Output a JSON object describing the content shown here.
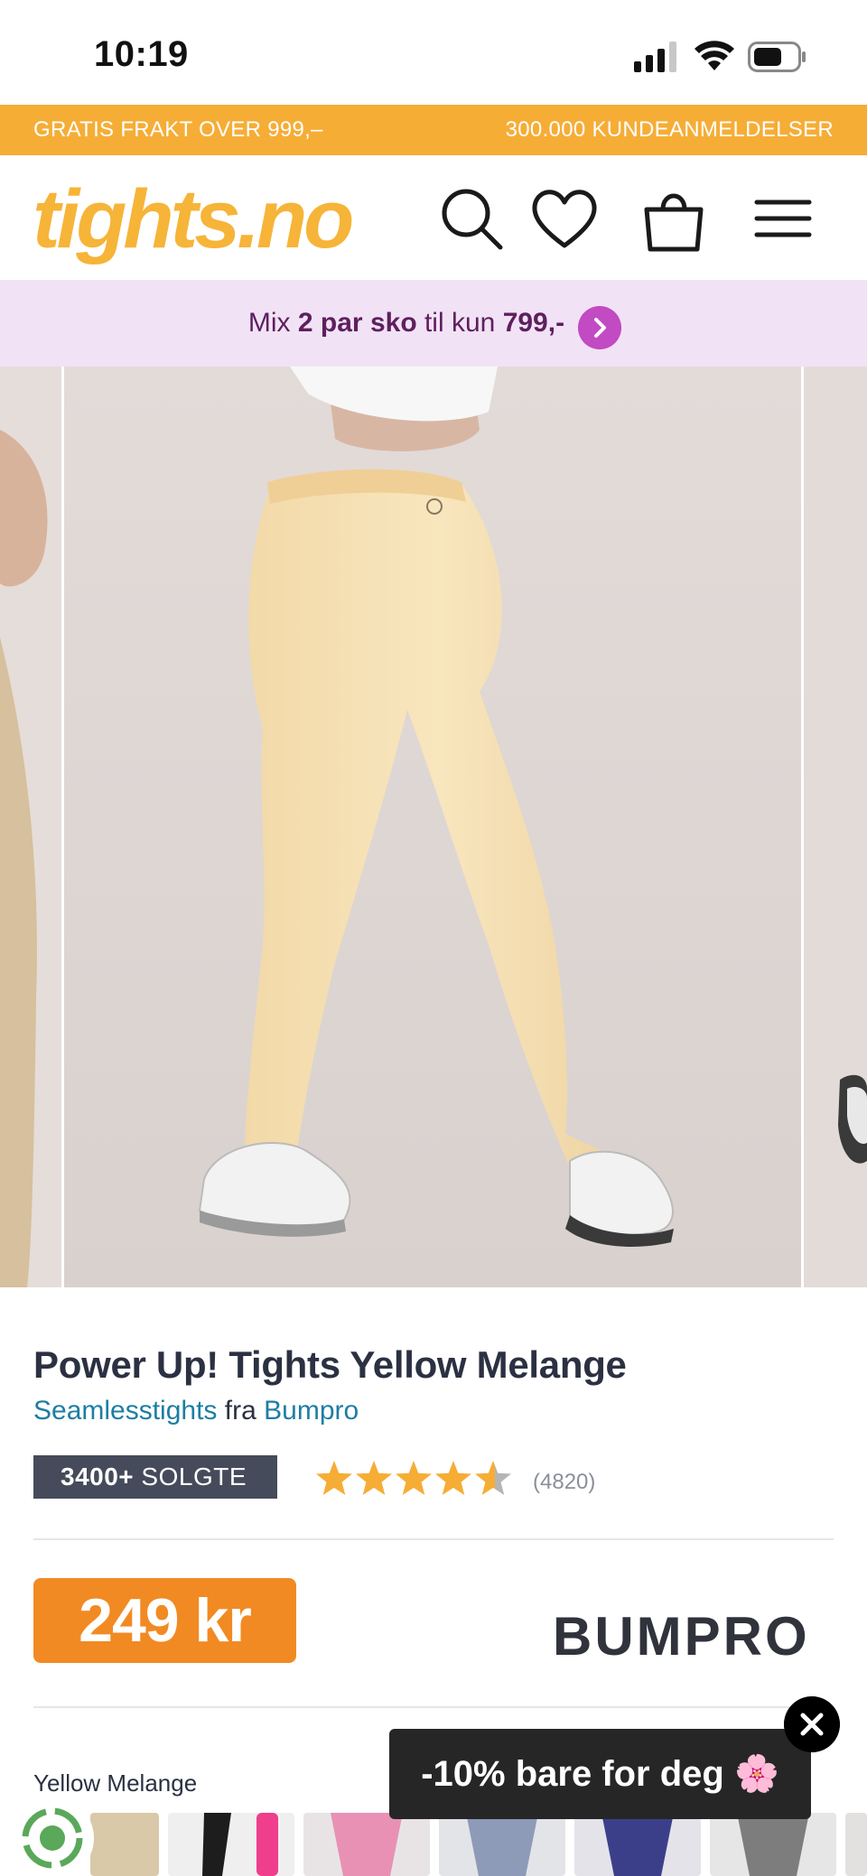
{
  "status_bar": {
    "time": "10:19"
  },
  "promo_bar": {
    "left_text": "GRATIS FRAKT OVER 999,–",
    "right_text": "300.000 KUNDEANMELDELSER"
  },
  "header": {
    "logo_text": "tights.no",
    "icons": [
      "search-icon",
      "heart-icon",
      "shopping-bag-icon",
      "menu-icon"
    ]
  },
  "offer_banner": {
    "text_prefix": "Mix ",
    "text_bold_1": "2 par sko",
    "text_middle": " til kun ",
    "text_bold_2": "799,-"
  },
  "product": {
    "title": "Power Up! Tights Yellow Melange",
    "category_link": "Seamlesstights",
    "from_word": "fra",
    "brand_link": "Bumpro",
    "sold_count": "3400+",
    "sold_label": "SOLGTE",
    "rating": 4.5,
    "rating_max": 5,
    "review_count": "(4820)",
    "price": "249 kr",
    "brand_logo_text": "BUMPRO",
    "color_label": "Yellow Melange"
  },
  "popup": {
    "text": "-10% bare for deg",
    "emoji": "🌸"
  },
  "colors": {
    "promo_bar": "#f6ad36",
    "logo": "#f6b438",
    "offer_banner_bg": "#f1e3f5",
    "offer_text": "#5e1f5e",
    "offer_arrow": "#c24ac2",
    "link": "#1d7ea3",
    "sold_badge": "#454b5a",
    "star": "#f6ad36",
    "price_badge": "#f18a23",
    "popup_bg": "#262626"
  }
}
